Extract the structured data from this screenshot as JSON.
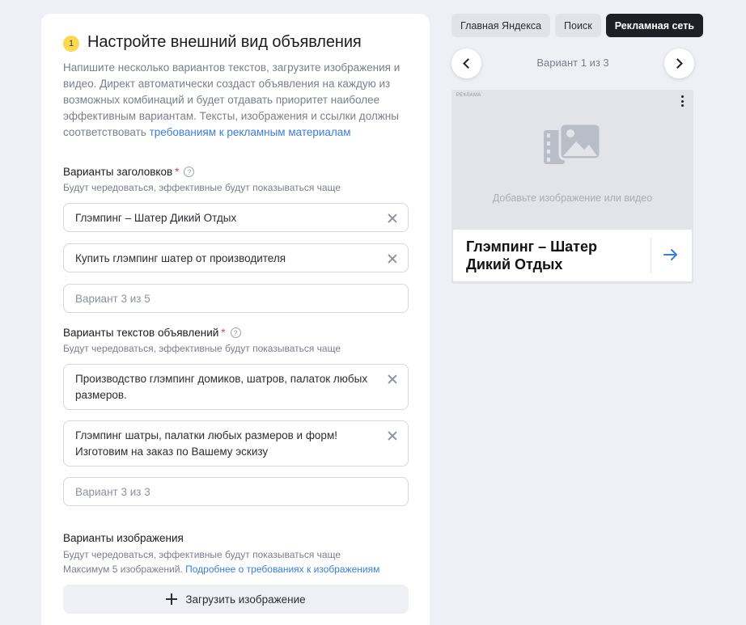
{
  "step": {
    "number": "1",
    "title": "Настройте внешний вид объявления"
  },
  "intro": {
    "text": "Напишите несколько вариантов текстов, загрузите изображения и видео. Директ автоматически создаст объявления на каждую из возможных комбинаций и будет отдавать приоритет наиболее эффективным вариантам. Тексты, изображения и ссылки должны соответствовать ",
    "link": "требованиям к рекламным материалам"
  },
  "headlines": {
    "label": "Варианты заголовков",
    "required_mark": "*",
    "hint": "Будут чередоваться, эффективные будут показываться чаще",
    "items": [
      "Глэмпинг – Шатер Дикий Отдых",
      "Купить глэмпинг шатер от производителя"
    ],
    "placeholder": "Вариант 3 из 5"
  },
  "texts": {
    "label": "Варианты текстов объявлений",
    "required_mark": "*",
    "hint": "Будут чередоваться, эффективные будут показываться чаще",
    "items": [
      "Производство глэмпинг домиков, шатров, палаток любых размеров.",
      "Глэмпинг шатры, палатки любых размеров и форм! Изготовим на заказ по Вашему эскизу"
    ],
    "placeholder": "Вариант 3 из 3"
  },
  "images": {
    "label": "Варианты изображения",
    "hint": "Будут чередоваться, эффективные будут показываться чаще",
    "hint2": "Максимум 5 изображений. ",
    "hint2_link": "Подробнее о требованиях к изображениям",
    "upload_label": "Загрузить изображение"
  },
  "preview_tabs": [
    "Главная Яндекса",
    "Поиск",
    "Рекламная сеть"
  ],
  "active_tab_index": 2,
  "variant_nav": {
    "text": "Вариант 1 из 3"
  },
  "preview": {
    "ad_mark": "РЕКЛАМА",
    "media_placeholder": "Добавьте изображение или видео",
    "title": "Глэмпинг – Шатер Дикий Отдых"
  },
  "colors": {
    "accent_link": "#3b7ddd",
    "badge": "#fdd94f",
    "active_tab": "#1e2026",
    "required": "#e5463b"
  },
  "icons": [
    "help-icon",
    "clear-icon",
    "plus-icon",
    "chevron-left-icon",
    "chevron-right-icon",
    "more-icon",
    "media-icon",
    "arrow-right-icon"
  ]
}
